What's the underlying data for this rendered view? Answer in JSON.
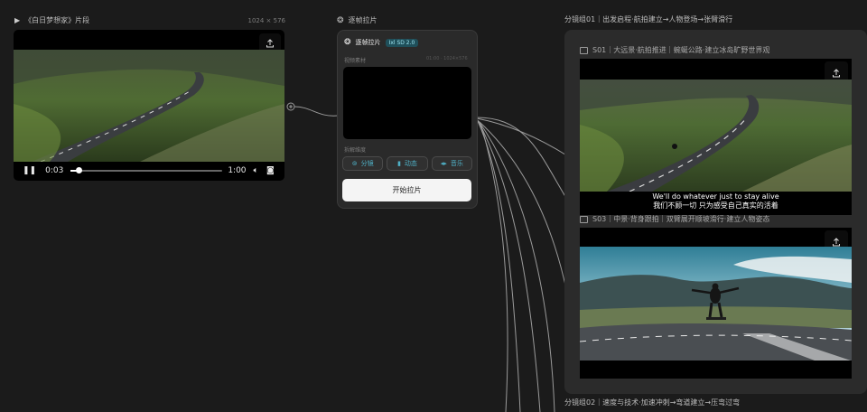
{
  "source_node": {
    "title": "《白日梦想家》片段",
    "resolution": "1024 × 576",
    "current_time": "0:03",
    "total_time": "1:00",
    "progress": 0.05
  },
  "extract_panel": {
    "header": "逐帧拉片",
    "title": "逐帧拉片",
    "badge": "Ixl SD 2.0",
    "video_label": "视频素材",
    "video_meta": "01:00 · 1024×576",
    "dimension_label": "拆解维度",
    "chips": [
      {
        "label": "分镜",
        "icon": "scene-icon"
      },
      {
        "label": "动态",
        "icon": "film-icon"
      },
      {
        "label": "音乐",
        "icon": "music-icon"
      }
    ],
    "start_button": "开始拉片"
  },
  "group1": {
    "title": "分镜组01｜出发启程·航拍建立→人物登场→张臂滑行",
    "scene1": {
      "label": "S01｜大远景·航拍推进｜蜿蜒公路·建立冰岛旷野世界观",
      "subtitle_en": "We'll do whatever just to stay alive",
      "subtitle_zh": "我们不顾一切 只为感受自己真实的活着"
    },
    "scene2": {
      "label": "S03｜中景·背身跟拍｜双臂展开顺坡滑行·建立人物姿态"
    }
  },
  "group2": {
    "title": "分镜组02｜速度与技术·加速冲刺→弯道建立→压弯过弯"
  },
  "colors": {
    "background": "#1b1b1b",
    "panel": "#2a2a2a",
    "accent": "#4fb0c6",
    "badge_bg": "#1f4f5a"
  }
}
